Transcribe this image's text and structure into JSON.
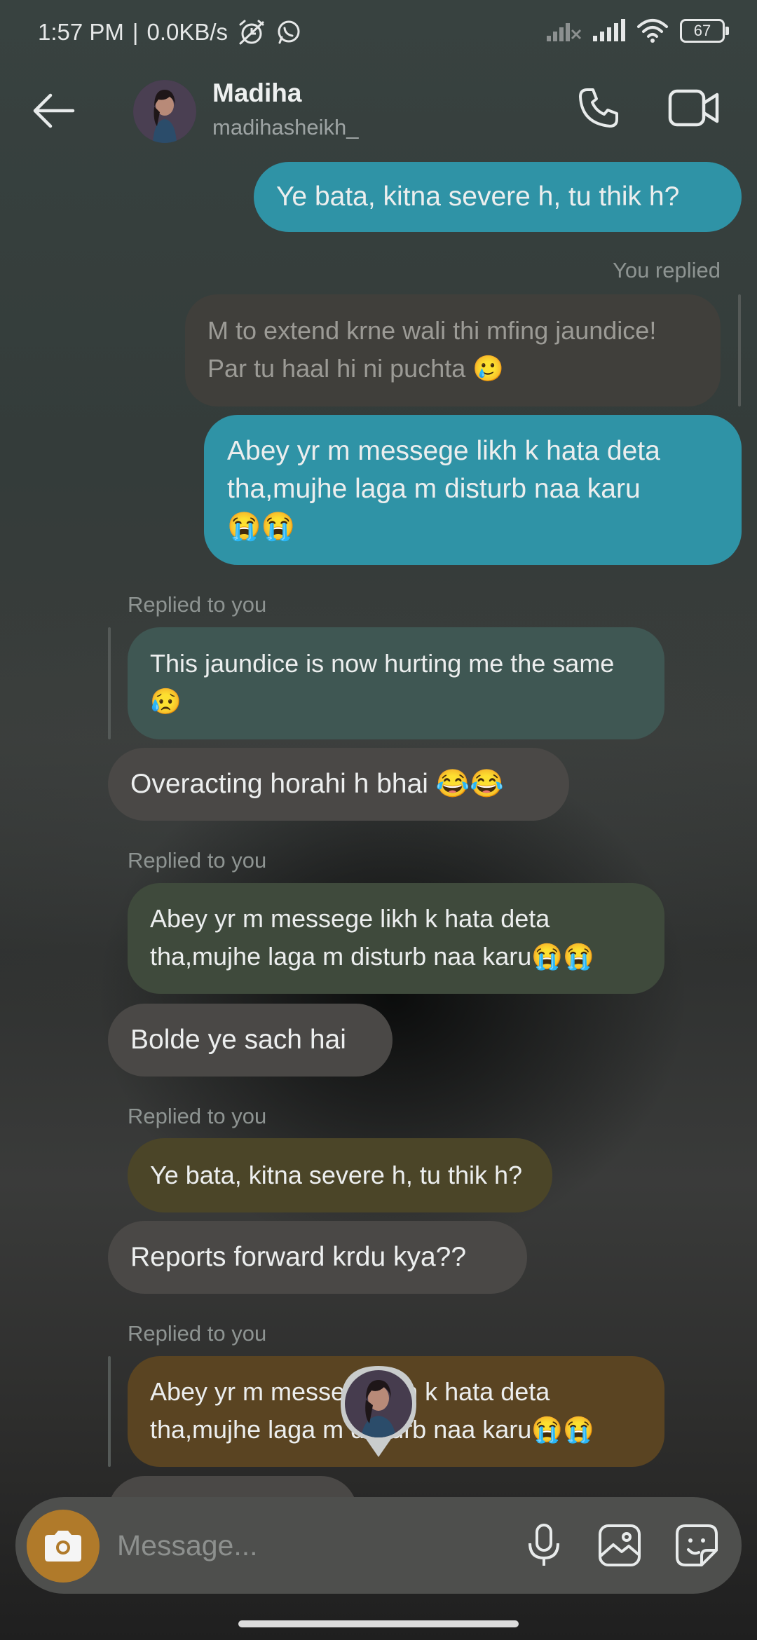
{
  "status_bar": {
    "time": "1:57 PM",
    "separator": "|",
    "speed": "0.0KB/s",
    "battery": "67",
    "icons": [
      "silent-alarm-icon",
      "whatsapp-icon",
      "signal-icon",
      "wifi-icon",
      "battery-icon"
    ]
  },
  "header": {
    "name": "Madiha",
    "handle": "madihasheikh_",
    "icons": [
      "back-arrow-icon",
      "phone-icon",
      "video-camera-icon"
    ]
  },
  "messages": [
    {
      "type": "sent",
      "text": "Ye bata, kitna severe h, tu thik h?"
    },
    {
      "type": "meta",
      "text": "You replied"
    },
    {
      "type": "quote",
      "lines": [
        "M to extend krne wali thi mfing jaundice!",
        "Par tu haal hi ni puchta 🥲"
      ]
    },
    {
      "type": "sent",
      "lines": [
        "Abey yr m messege likh k hata deta",
        "tha,mujhe laga m disturb naa karu",
        "😭😭"
      ]
    },
    {
      "type": "meta",
      "text": "Replied to you"
    },
    {
      "type": "quote",
      "lines": [
        "This jaundice is now hurting me the same",
        "😥"
      ]
    },
    {
      "type": "received",
      "text": "Overacting horahi h bhai 😂😂"
    },
    {
      "type": "meta",
      "text": "Replied to you"
    },
    {
      "type": "quote",
      "lines": [
        "Abey yr m messege likh k hata deta",
        "tha,mujhe laga m disturb naa karu😭😭"
      ]
    },
    {
      "type": "received",
      "text": "Bolde ye sach hai"
    },
    {
      "type": "meta",
      "text": "Replied to you"
    },
    {
      "type": "quote",
      "text": "Ye bata, kitna severe h, tu thik h?"
    },
    {
      "type": "received",
      "text": "Reports forward krdu kya??"
    },
    {
      "type": "meta",
      "text": "Replied to you"
    },
    {
      "type": "quote",
      "lines": [
        "Abey yr m messege likh k hata deta",
        "tha,mujhe laga m disturb naa karu😭😭"
      ]
    }
  ],
  "composer": {
    "placeholder": "Message...",
    "icons": [
      "camera-icon",
      "microphone-icon",
      "gallery-icon",
      "sticker-icon"
    ]
  },
  "colors": {
    "sent_bubble": "#2f93a6",
    "received_bubble": "#4a4846",
    "quote_teal": "#3f5753",
    "quote_olive": "#3f4a3c",
    "quote_khaki": "#4b4528",
    "quote_amber": "#5a4422",
    "camera_button": "#b07a2a"
  }
}
